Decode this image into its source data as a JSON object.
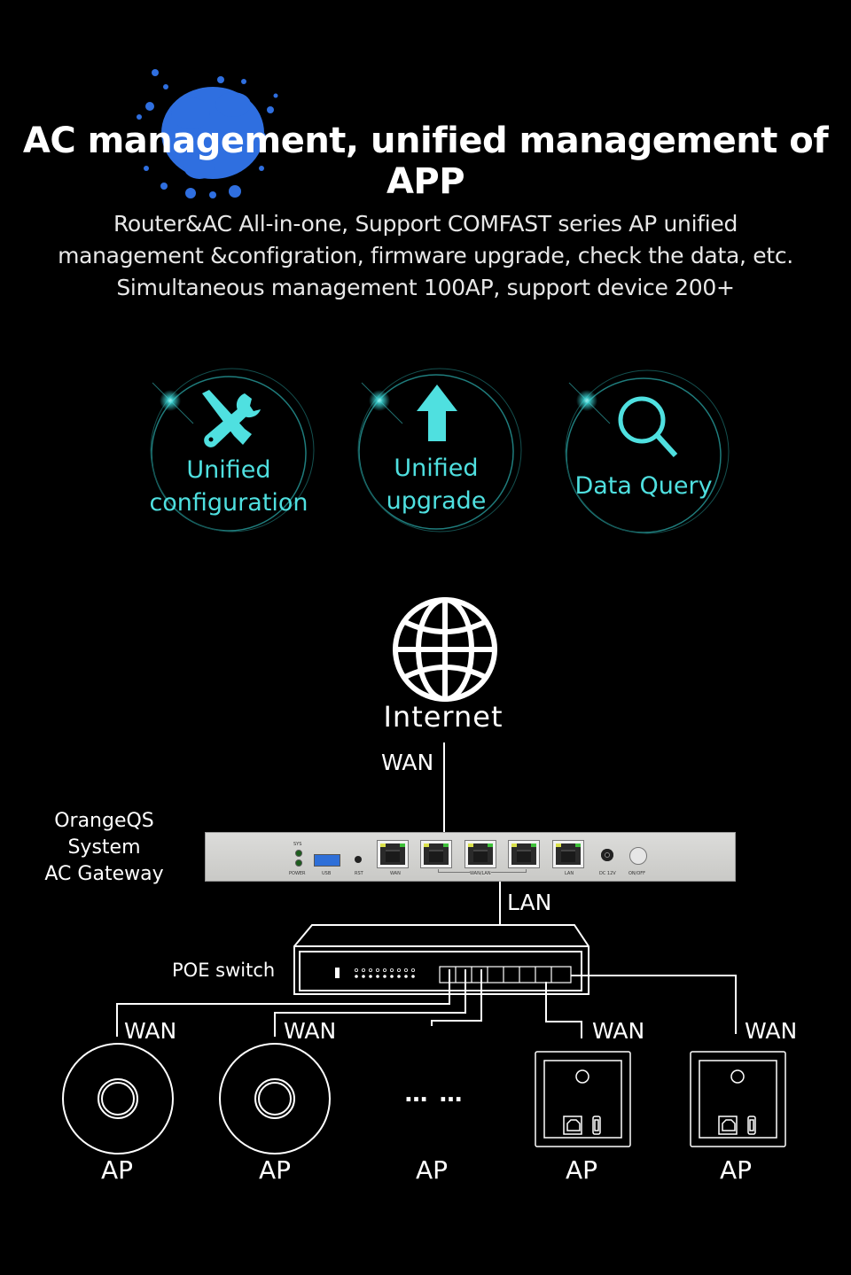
{
  "header": {
    "title": "AC management, unified management of APP",
    "subtitle_lines": [
      "Router&AC All-in-one, Support COMFAST series AP unified",
      "management &configration, firmware upgrade, check the data, etc.",
      "Simultaneous management 100AP, support device 200+"
    ],
    "accent_color": "#2f6fe0"
  },
  "features": [
    {
      "icon": "wrench-screwdriver-icon",
      "lines": [
        "Unified",
        "configuration"
      ]
    },
    {
      "icon": "up-arrow-icon",
      "lines": [
        "Unified",
        "upgrade"
      ]
    },
    {
      "icon": "magnifier-icon",
      "lines": [
        "Data Query"
      ]
    }
  ],
  "feature_color": "#4fe0e0",
  "diagram": {
    "internet_label": "Internet",
    "internet_link_label": "WAN",
    "gateway": {
      "label_lines": [
        "OrangeQS",
        "System",
        "AC Gateway"
      ],
      "panel_labels": {
        "sys": "SYS",
        "power": "POWER",
        "usb": "USB",
        "rst": "RST",
        "wan": "WAN",
        "wan_lan": "WAN/LAN",
        "lan": "LAN",
        "dc": "DC 12V",
        "onoff": "ON/OFF"
      }
    },
    "gateway_link_label": "LAN",
    "switch_label": "POE switch",
    "aps": [
      {
        "type": "ceiling",
        "link_label": "WAN",
        "label": "AP"
      },
      {
        "type": "ceiling",
        "link_label": "WAN",
        "label": "AP"
      },
      {
        "type": "more",
        "link_label": "",
        "label": "AP",
        "ellipsis": "… …"
      },
      {
        "type": "wall-panel",
        "link_label": "WAN",
        "label": "AP"
      },
      {
        "type": "wall-panel",
        "link_label": "WAN",
        "label": "AP"
      }
    ]
  }
}
